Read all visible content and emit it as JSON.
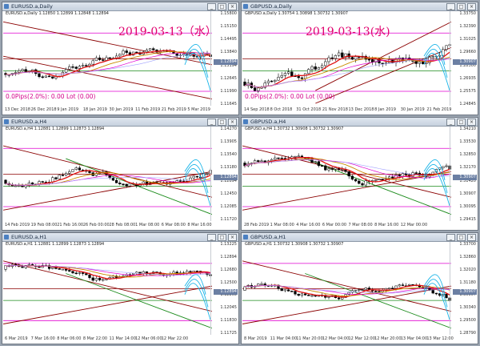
{
  "windows": [
    {
      "id": "w1",
      "title": "EURUSD.a,Daily",
      "ohlc": "EURUSD.a,Daily 1.12850 1.12899 1.12848 1.12894",
      "date_label": "2019-03-13（水）",
      "pips": "0.0Pips(2.0%): 0.00 Lot (0.00)",
      "xlabels": [
        "13 Dec 2018",
        "26 Dec 2018",
        "9 Jan 2019",
        "18 Jan 2019",
        "30 Jan 2019",
        "11 Feb 2019",
        "21 Feb 2019",
        "5 Mar 2019"
      ],
      "ylabels": [
        "1.15800",
        "1.15150",
        "1.14495",
        "1.13840",
        "1.13194",
        "1.12645",
        "1.11990",
        "1.11645"
      ],
      "price_tag": "1.12894"
    },
    {
      "id": "w2",
      "title": "GBPUSD.a,Daily",
      "ohlc": "GBPUSD.a,Daily 1.30754 1.30898 1.30732 1.30907",
      "date_label": "2019-03-13(水)",
      "pips": "0.0Pips(2.0%): 0.00 Lot (0.00)",
      "xlabels": [
        "14 Sep 2018",
        "8 Oct 2018",
        "31 Oct 2018",
        "21 Nov 2018",
        "13 Dec 2018",
        "8 Jan 2019",
        "30 Jan 2019",
        "21 Feb 2019"
      ],
      "ylabels": [
        "1.33750",
        "1.32390",
        "1.31025",
        "1.29660",
        "1.28300",
        "1.26935",
        "1.25575",
        "1.24845"
      ],
      "price_tag": "1.30907"
    },
    {
      "id": "w3",
      "title": "EURUSD.a,H4",
      "ohlc": "EURUSD.a,H4 1.12881 1.12899 1.12873 1.12894",
      "date_label": "",
      "pips": "",
      "xlabels": [
        "14 Feb 2019",
        "19 Feb 08:00",
        "21 Feb 16:00",
        "26 Feb 00:00",
        "28 Feb 08:00",
        "1 Mar 08:00",
        "6 Mar 08:00",
        "8 Mar 16:00"
      ],
      "ylabels": [
        "1.14270",
        "1.13905",
        "1.13540",
        "1.13180",
        "1.12894",
        "1.12450",
        "1.12085",
        "1.11720"
      ],
      "price_tag": "1.12894"
    },
    {
      "id": "w4",
      "title": "GBPUSD.a,H4",
      "ohlc": "GBPUSD.a,H4 1.30732 1.30908 1.30732 1.30907",
      "date_label": "",
      "pips": "",
      "xlabels": [
        "28 Feb 2019",
        "1 Mar 08:00",
        "4 Mar 16:00",
        "6 Mar 00:00",
        "7 Mar 08:00",
        "8 Mar 16:00",
        "12 Mar 00:00",
        ""
      ],
      "ylabels": [
        "1.34210",
        "1.33530",
        "1.32850",
        "1.32170",
        "1.31420",
        "1.30907",
        "1.30095",
        "1.29415"
      ],
      "price_tag": "1.30907"
    },
    {
      "id": "w5",
      "title": "EURUSD.a,H1",
      "ohlc": "EURUSD.a,H1 1.12881 1.12899 1.12873 1.12894",
      "date_label": "",
      "pips": "",
      "xlabels": [
        "6 Mar 2019",
        "7 Mar 16:00",
        "8 Mar 06:00",
        "8 Mar 22:00",
        "11 Mar 14:00",
        "12 Mar 06:00",
        "12 Mar 22:00",
        ""
      ],
      "ylabels": [
        "1.13225",
        "1.12894",
        "1.12680",
        "1.12500",
        "1.12265",
        "1.12045",
        "1.11830",
        "1.11725"
      ],
      "price_tag": "1.12894"
    },
    {
      "id": "w6",
      "title": "GBPUSD.a,H1",
      "ohlc": "GBPUSD.a,H1 1.30732 1.30908 1.30732 1.30907",
      "date_label": "",
      "pips": "",
      "xlabels": [
        "8 Mar 2019",
        "11 Mar 04:00",
        "11 Mar 20:00",
        "12 Mar 04:00",
        "12 Mar 12:00",
        "12 Mar 20:00",
        "13 Mar 04:00",
        "13 Mar 12:00"
      ],
      "ylabels": [
        "1.33700",
        "1.32860",
        "1.32020",
        "1.31180",
        "1.30907",
        "1.30340",
        "1.29500",
        "1.28790"
      ],
      "price_tag": "1.30907"
    }
  ],
  "colors": {
    "bull": "#ffffff",
    "bear": "#000000",
    "ma_red": "#e01010",
    "ma_orange": "#c98a00",
    "ma_magenta": "#e000d0",
    "ma_purple": "#a0a0ff",
    "trend_dark": "#8b0000",
    "trend_green": "#1a8a1a",
    "cyan": "#18b4e8",
    "price_box": "#6b7fa3",
    "tag_red": "#e0006e"
  }
}
